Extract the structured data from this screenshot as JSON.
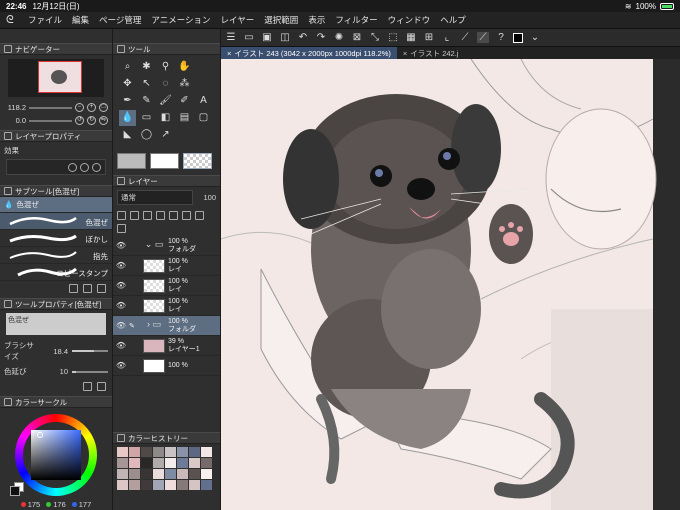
{
  "status": {
    "time": "22:46",
    "date": "12月12日(日)",
    "battery": "100%"
  },
  "menu": [
    "ファイル",
    "編集",
    "ページ管理",
    "アニメーション",
    "レイヤー",
    "選択範囲",
    "表示",
    "フィルター",
    "ウィンドウ",
    "ヘルプ"
  ],
  "navigator": {
    "title": "ナビゲーター",
    "zoom": "118.2",
    "rotation": "0.0"
  },
  "layer_property": {
    "title": "レイヤープロパティ",
    "effect_label": "効果"
  },
  "subtool": {
    "title": "サブツール[色混ぜ]",
    "header": "色混ぜ",
    "brushes": [
      {
        "label": "色混ぜ"
      },
      {
        "label": "ぼかし"
      },
      {
        "label": "指先"
      },
      {
        "label": "コピースタンプ"
      }
    ]
  },
  "tool_property": {
    "title": "ツールプロパティ[色混ぜ]",
    "header": "色混ぜ",
    "brush_size_label": "ブラシサイズ",
    "brush_size": "18.4",
    "color_stretch_label": "色延び",
    "color_stretch": "10"
  },
  "color_circle": {
    "title": "カラーサークル",
    "r": "175",
    "g": "176",
    "b": "177"
  },
  "tools": {
    "title": "ツール"
  },
  "layers": {
    "title": "レイヤー",
    "blend": "通常",
    "opacity": "100",
    "rows": [
      {
        "opacity": "100 %",
        "name": "フォルダ"
      },
      {
        "opacity": "100 %",
        "name": "レイ"
      },
      {
        "opacity": "100 %",
        "name": "レイ"
      },
      {
        "opacity": "100 %",
        "name": "レイ"
      },
      {
        "opacity": "100 %",
        "name": "フォルダ"
      },
      {
        "opacity": "39 %",
        "name": "レイヤー1"
      },
      {
        "opacity": "100 %",
        "name": ""
      }
    ]
  },
  "color_history": {
    "title": "カラーヒストリー"
  },
  "tabs": [
    {
      "label": "イラスト 243 (3042 x 2000px 1000dpi 118.2%)"
    },
    {
      "label": "イラスト 242.j"
    }
  ],
  "colors": {
    "accent": "#5d6d82",
    "tab_active": "#3a4f70"
  }
}
